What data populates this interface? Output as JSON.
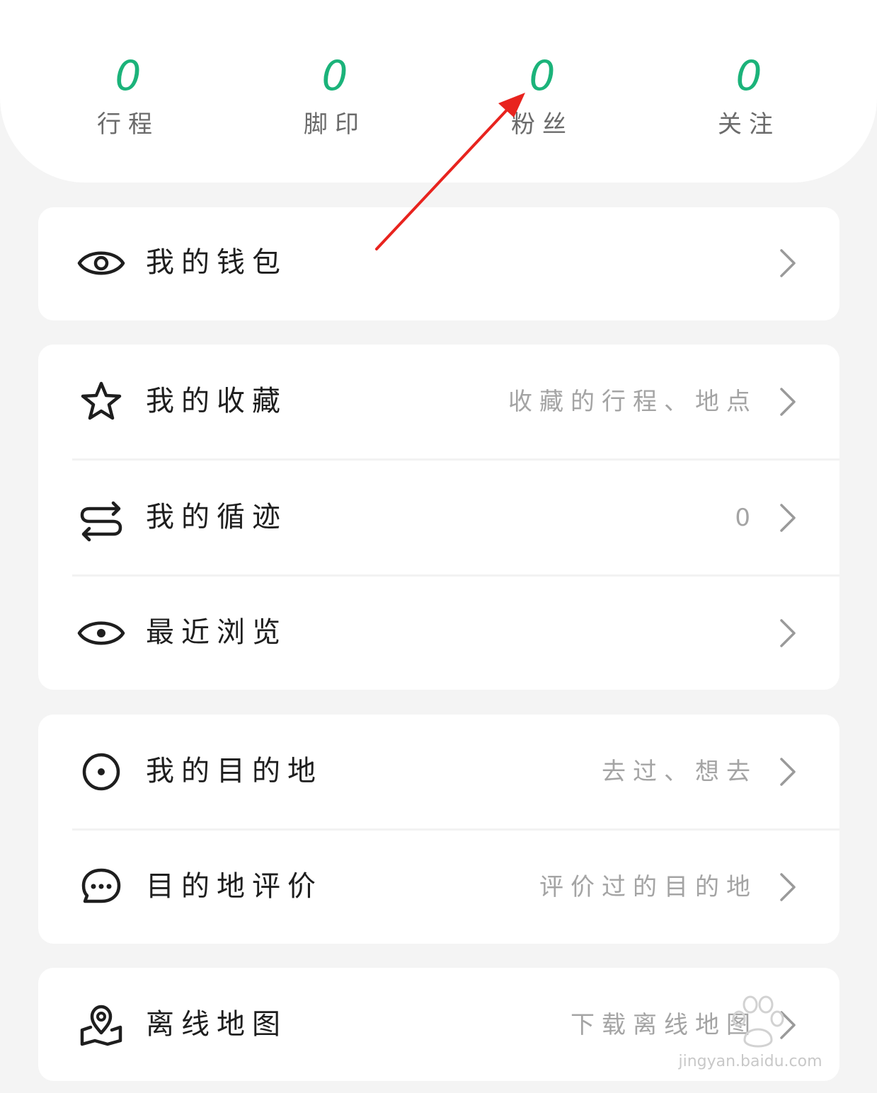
{
  "stats": [
    {
      "value": "0",
      "label": "行程"
    },
    {
      "value": "0",
      "label": "脚印"
    },
    {
      "value": "0",
      "label": "粉丝"
    },
    {
      "value": "0",
      "label": "关注"
    }
  ],
  "menu": {
    "wallet": {
      "label": "我的钱包",
      "icon": "eye-icon"
    },
    "favorites": {
      "label": "我的收藏",
      "hint": "收藏的行程、地点",
      "icon": "star-icon"
    },
    "tracks": {
      "label": "我的循迹",
      "hint": "0",
      "icon": "swap-arrows-icon"
    },
    "recent": {
      "label": "最近浏览",
      "icon": "eye-icon"
    },
    "destinations": {
      "label": "我的目的地",
      "hint": "去过、想去",
      "icon": "target-icon"
    },
    "reviews": {
      "label": "目的地评价",
      "hint": "评价过的目的地",
      "icon": "chat-bubble-icon"
    },
    "offline_map": {
      "label": "离线地图",
      "hint": "下载离线地图",
      "icon": "map-pin-icon"
    }
  },
  "watermark": {
    "text": "jingyan.baidu.com"
  },
  "colors": {
    "accent": "#1bb37a",
    "annotation": "#e8231e",
    "text_primary": "#1e1e1e",
    "text_secondary": "#a4a4a4",
    "background": "#f4f4f4"
  }
}
